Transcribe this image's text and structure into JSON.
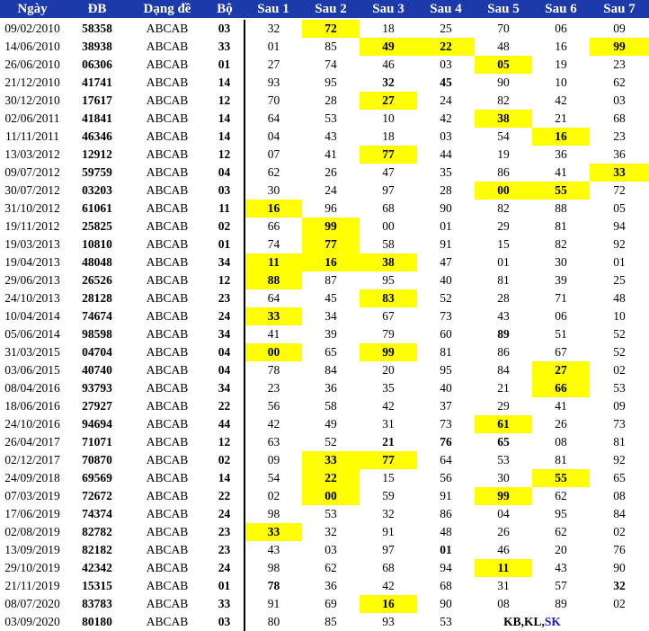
{
  "headers": [
    "Ngày",
    "ĐB",
    "Dạng đề",
    "Bộ",
    "Sau 1",
    "Sau 2",
    "Sau 3",
    "Sau 4",
    "Sau 5",
    "Sau 6",
    "Sau 7"
  ],
  "colors": {
    "header_bg": "#1c3aa9",
    "highlight_bg": "#ffff00",
    "red": "#e21010",
    "blue": "#1a1ac8"
  },
  "rows": [
    {
      "date": "09/02/2010",
      "db": "58358",
      "form": "ABCAB",
      "bo": "03",
      "after": [
        "32",
        "72",
        "18",
        "25",
        "70",
        "06",
        "09"
      ],
      "hl": [
        1
      ],
      "blue": []
    },
    {
      "date": "14/06/2010",
      "db": "38938",
      "form": "ABCAB",
      "bo": "33",
      "after": [
        "01",
        "85",
        "49",
        "22",
        "48",
        "16",
        "99"
      ],
      "hl": [
        2,
        3,
        6
      ],
      "blue": []
    },
    {
      "date": "26/06/2010",
      "db": "06306",
      "form": "ABCAB",
      "bo": "01",
      "after": [
        "27",
        "74",
        "46",
        "03",
        "05",
        "19",
        "23"
      ],
      "hl": [
        4
      ],
      "blue": []
    },
    {
      "date": "21/12/2010",
      "db": "41741",
      "form": "ABCAB",
      "bo": "14",
      "after": [
        "93",
        "95",
        "32",
        "45",
        "90",
        "10",
        "62"
      ],
      "hl": [],
      "blue": [
        2,
        3
      ]
    },
    {
      "date": "30/12/2010",
      "db": "17617",
      "form": "ABCAB",
      "bo": "12",
      "after": [
        "70",
        "28",
        "27",
        "24",
        "82",
        "42",
        "03"
      ],
      "hl": [
        2
      ],
      "blue": []
    },
    {
      "date": "02/06/2011",
      "db": "41841",
      "form": "ABCAB",
      "bo": "14",
      "after": [
        "64",
        "53",
        "10",
        "42",
        "38",
        "21",
        "68"
      ],
      "hl": [
        4
      ],
      "blue": []
    },
    {
      "date": "11/11/2011",
      "db": "46346",
      "form": "ABCAB",
      "bo": "14",
      "after": [
        "04",
        "43",
        "18",
        "03",
        "54",
        "16",
        "23"
      ],
      "hl": [
        5
      ],
      "blue": []
    },
    {
      "date": "13/03/2012",
      "db": "12912",
      "form": "ABCAB",
      "bo": "12",
      "after": [
        "07",
        "41",
        "77",
        "44",
        "19",
        "36",
        "36"
      ],
      "hl": [
        2
      ],
      "blue": []
    },
    {
      "date": "09/07/2012",
      "db": "59759",
      "form": "ABCAB",
      "bo": "04",
      "after": [
        "62",
        "26",
        "47",
        "35",
        "86",
        "41",
        "33"
      ],
      "hl": [
        6
      ],
      "blue": []
    },
    {
      "date": "30/07/2012",
      "db": "03203",
      "form": "ABCAB",
      "bo": "03",
      "after": [
        "30",
        "24",
        "97",
        "28",
        "00",
        "55",
        "72"
      ],
      "hl": [
        4,
        5
      ],
      "blue": []
    },
    {
      "date": "31/10/2012",
      "db": "61061",
      "form": "ABCAB",
      "bo": "11",
      "after": [
        "16",
        "96",
        "68",
        "90",
        "82",
        "88",
        "05"
      ],
      "hl": [
        0
      ],
      "blue": []
    },
    {
      "date": "19/11/2012",
      "db": "25825",
      "form": "ABCAB",
      "bo": "02",
      "after": [
        "66",
        "99",
        "00",
        "01",
        "29",
        "81",
        "94"
      ],
      "hl": [
        1
      ],
      "blue": []
    },
    {
      "date": "19/03/2013",
      "db": "10810",
      "form": "ABCAB",
      "bo": "01",
      "after": [
        "74",
        "77",
        "58",
        "91",
        "15",
        "82",
        "92"
      ],
      "hl": [
        1
      ],
      "blue": []
    },
    {
      "date": "19/04/2013",
      "db": "48048",
      "form": "ABCAB",
      "bo": "34",
      "after": [
        "11",
        "16",
        "38",
        "47",
        "01",
        "30",
        "01"
      ],
      "hl": [
        0,
        1,
        2
      ],
      "blue": []
    },
    {
      "date": "29/06/2013",
      "db": "26526",
      "form": "ABCAB",
      "bo": "12",
      "after": [
        "88",
        "87",
        "95",
        "40",
        "81",
        "39",
        "25"
      ],
      "hl": [
        0
      ],
      "blue": []
    },
    {
      "date": "24/10/2013",
      "db": "28128",
      "form": "ABCAB",
      "bo": "23",
      "after": [
        "64",
        "45",
        "83",
        "52",
        "28",
        "71",
        "48"
      ],
      "hl": [
        2
      ],
      "blue": []
    },
    {
      "date": "10/04/2014",
      "db": "74674",
      "form": "ABCAB",
      "bo": "24",
      "after": [
        "33",
        "34",
        "67",
        "73",
        "43",
        "06",
        "10"
      ],
      "hl": [
        0
      ],
      "blue": []
    },
    {
      "date": "05/06/2014",
      "db": "98598",
      "form": "ABCAB",
      "bo": "34",
      "after": [
        "41",
        "39",
        "79",
        "60",
        "89",
        "51",
        "52"
      ],
      "hl": [],
      "blue": [
        4
      ]
    },
    {
      "date": "31/03/2015",
      "db": "04704",
      "form": "ABCAB",
      "bo": "04",
      "after": [
        "00",
        "65",
        "99",
        "81",
        "86",
        "67",
        "52"
      ],
      "hl": [
        0,
        2
      ],
      "blue": []
    },
    {
      "date": "03/06/2015",
      "db": "40740",
      "form": "ABCAB",
      "bo": "04",
      "after": [
        "78",
        "84",
        "20",
        "95",
        "84",
        "27",
        "02"
      ],
      "hl": [
        5
      ],
      "blue": []
    },
    {
      "date": "08/04/2016",
      "db": "93793",
      "form": "ABCAB",
      "bo": "34",
      "after": [
        "23",
        "36",
        "35",
        "40",
        "21",
        "66",
        "53"
      ],
      "hl": [
        5
      ],
      "blue": []
    },
    {
      "date": "18/06/2016",
      "db": "27927",
      "form": "ABCAB",
      "bo": "22",
      "after": [
        "56",
        "58",
        "42",
        "37",
        "29",
        "41",
        "09"
      ],
      "hl": [],
      "blue": []
    },
    {
      "date": "24/10/2016",
      "db": "94694",
      "form": "ABCAB",
      "bo": "44",
      "after": [
        "42",
        "49",
        "31",
        "73",
        "61",
        "26",
        "73"
      ],
      "hl": [
        4
      ],
      "blue": []
    },
    {
      "date": "26/04/2017",
      "db": "71071",
      "form": "ABCAB",
      "bo": "12",
      "after": [
        "63",
        "52",
        "21",
        "76",
        "65",
        "08",
        "81"
      ],
      "hl": [],
      "blue": [
        2,
        3,
        4
      ]
    },
    {
      "date": "02/12/2017",
      "db": "70870",
      "form": "ABCAB",
      "bo": "02",
      "after": [
        "09",
        "33",
        "77",
        "64",
        "53",
        "81",
        "92"
      ],
      "hl": [
        1,
        2
      ],
      "blue": []
    },
    {
      "date": "24/09/2018",
      "db": "69569",
      "form": "ABCAB",
      "bo": "14",
      "after": [
        "54",
        "22",
        "15",
        "56",
        "30",
        "55",
        "65"
      ],
      "hl": [
        1,
        5
      ],
      "blue": []
    },
    {
      "date": "07/03/2019",
      "db": "72672",
      "form": "ABCAB",
      "bo": "22",
      "after": [
        "02",
        "00",
        "59",
        "91",
        "99",
        "62",
        "08"
      ],
      "hl": [
        1,
        4
      ],
      "blue": []
    },
    {
      "date": "17/06/2019",
      "db": "74374",
      "form": "ABCAB",
      "bo": "24",
      "after": [
        "98",
        "53",
        "32",
        "86",
        "04",
        "95",
        "84"
      ],
      "hl": [],
      "blue": []
    },
    {
      "date": "02/08/2019",
      "db": "82782",
      "form": "ABCAB",
      "bo": "23",
      "after": [
        "33",
        "32",
        "91",
        "48",
        "26",
        "62",
        "02"
      ],
      "hl": [
        0
      ],
      "blue": []
    },
    {
      "date": "13/09/2019",
      "db": "82182",
      "form": "ABCAB",
      "bo": "23",
      "after": [
        "43",
        "03",
        "97",
        "01",
        "46",
        "20",
        "76"
      ],
      "hl": [],
      "blue": [
        3
      ]
    },
    {
      "date": "29/10/2019",
      "db": "42342",
      "form": "ABCAB",
      "bo": "24",
      "after": [
        "98",
        "62",
        "68",
        "94",
        "11",
        "43",
        "90"
      ],
      "hl": [
        4
      ],
      "blue": []
    },
    {
      "date": "21/11/2019",
      "db": "15315",
      "form": "ABCAB",
      "bo": "01",
      "after": [
        "78",
        "36",
        "42",
        "68",
        "31",
        "57",
        "32"
      ],
      "hl": [],
      "blue": [
        0,
        6
      ]
    },
    {
      "date": "08/07/2020",
      "db": "83783",
      "form": "ABCAB",
      "bo": "33",
      "after": [
        "91",
        "69",
        "16",
        "90",
        "08",
        "89",
        "02"
      ],
      "hl": [
        2
      ],
      "blue": []
    },
    {
      "date": "03/09/2020",
      "db": "80180",
      "form": "ABCAB",
      "bo": "03",
      "after": [
        "80",
        "85",
        "93",
        "53"
      ],
      "hl": [],
      "blue": []
    }
  ],
  "legend": {
    "kb": "KB,KL,",
    "sk": "SK"
  }
}
